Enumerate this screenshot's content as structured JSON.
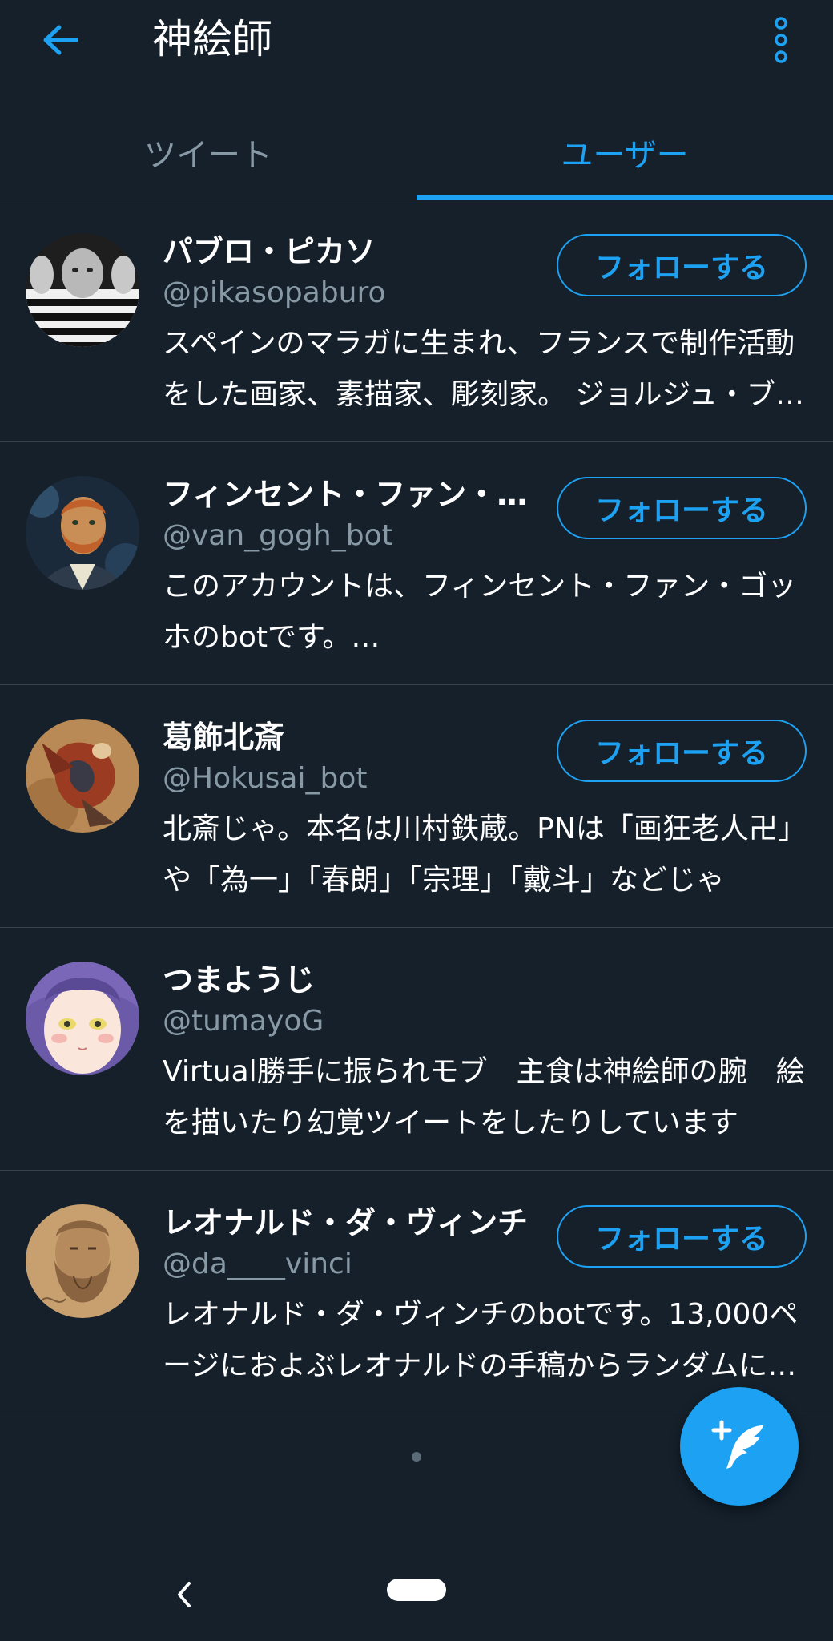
{
  "header": {
    "title": "神絵師",
    "back_icon": "arrow-left-icon",
    "more_icon": "more-vertical-icon"
  },
  "tabs": [
    {
      "label": "ツイート",
      "active": false
    },
    {
      "label": "ユーザー",
      "active": true
    }
  ],
  "users": [
    {
      "name": "パブロ・ピカソ",
      "handle": "@pikasopaburo",
      "bio": "スペインのマラガに生まれ、フランスで制作活動をした画家、素描家、彫刻家。 ジョルジュ・ブラックとともにキュビスムの創始者として知られる",
      "follow_label": "フォローする"
    },
    {
      "name": "フィンセント・ファン・ゴッホ",
      "handle": "@van_gogh_bot",
      "bio": "このアカウントは、フィンセント・ファン・ゴッホのbotです。…",
      "follow_label": "フォローする"
    },
    {
      "name": "葛飾北斎",
      "handle": "@Hokusai_bot",
      "bio": "北斎じゃ。本名は川村鉄蔵。PNは「画狂老人卍」や「為一」「春朗」「宗理」「戴斗」などじゃ",
      "follow_label": "フォローする"
    },
    {
      "name": "つまようじ",
      "handle": "@tumayoG",
      "bio": "Virtual勝手に振られモブ　主食は神絵師の腕　絵を描いたり幻覚ツイートをしたりしています",
      "follow_label": ""
    },
    {
      "name": "レオナルド・ダ・ヴィンチ",
      "handle": "@da____vinci",
      "bio": "レオナルド・ダ・ヴィンチのbotです。13,000ページにおよぶレオナルドの手稿からランダムに引用します",
      "follow_label": "フォローする"
    }
  ],
  "fab": {
    "icon": "compose-tweet-icon"
  },
  "system_nav": {
    "back_icon": "chevron-left-icon",
    "home_icon": "home-pill-icon"
  },
  "colors": {
    "background": "#15202b",
    "accent": "#1da1f2",
    "secondary_text": "#8899a6",
    "divider": "#38444d"
  }
}
